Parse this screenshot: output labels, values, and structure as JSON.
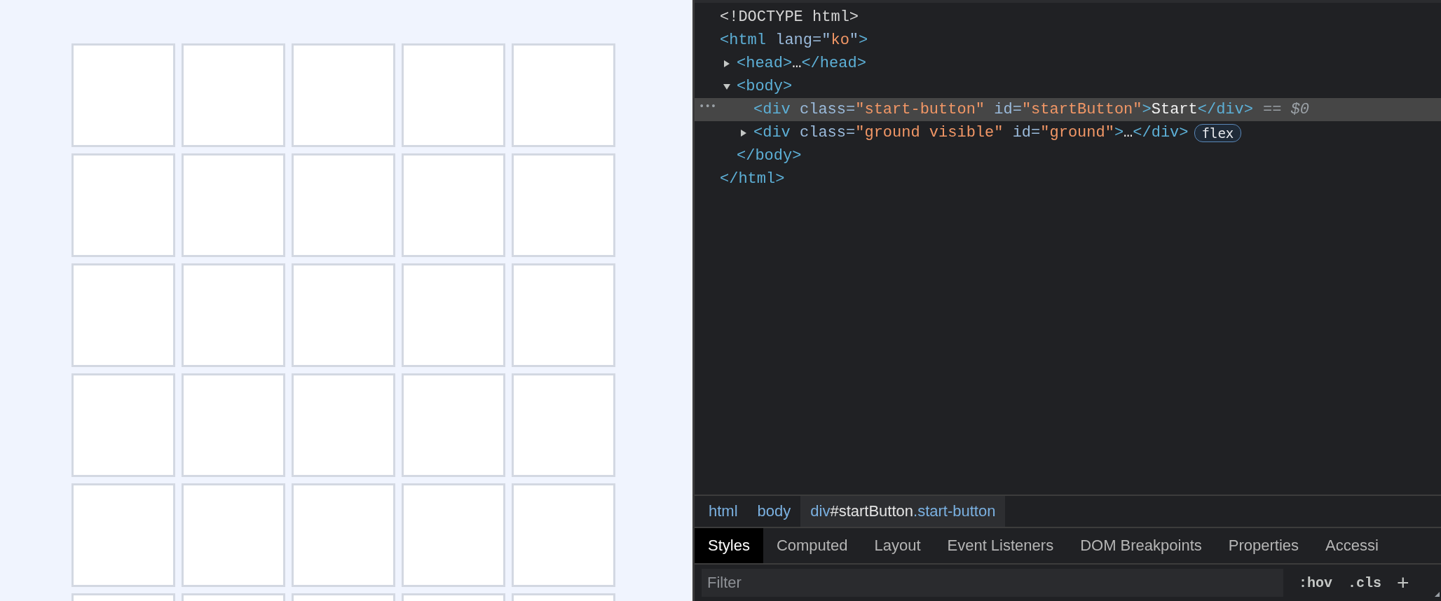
{
  "dom_tree": [
    {
      "selected": false,
      "parts": [
        {
          "kind": "doctype",
          "text": "<!DOCTYPE html>"
        }
      ]
    },
    {
      "selected": false,
      "parts": [
        {
          "kind": "tag",
          "text": "<html"
        },
        {
          "kind": "attr",
          "text": " lang=\""
        },
        {
          "kind": "value",
          "text": "ko"
        },
        {
          "kind": "attr",
          "text": "\""
        },
        {
          "kind": "tag",
          "text": ">"
        }
      ],
      "closing": [
        {
          "kind": "tag",
          "text": "</html>"
        }
      ],
      "children": [
        {
          "selected": false,
          "expanded": false,
          "parts": [
            {
              "kind": "tag",
              "text": "<head>"
            },
            {
              "kind": "text",
              "text": "…"
            },
            {
              "kind": "tag",
              "text": "</head>"
            }
          ]
        },
        {
          "selected": false,
          "expanded": true,
          "parts": [
            {
              "kind": "tag",
              "text": "<body>"
            }
          ],
          "closing": [
            {
              "kind": "tag",
              "text": "</body>"
            }
          ],
          "children": [
            {
              "selected": true,
              "marker": "•••",
              "suffix": "== $0",
              "parts": [
                {
                  "kind": "tag",
                  "text": "<div"
                },
                {
                  "kind": "attr",
                  "text": " class="
                },
                {
                  "kind": "value",
                  "text": "\"start-button\""
                },
                {
                  "kind": "attr",
                  "text": " id="
                },
                {
                  "kind": "value",
                  "text": "\"startButton\""
                },
                {
                  "kind": "tag",
                  "text": ">"
                },
                {
                  "kind": "text",
                  "text": "Start"
                },
                {
                  "kind": "tag",
                  "text": "</div>"
                }
              ]
            },
            {
              "selected": false,
              "expanded": false,
              "badge": "flex",
              "parts": [
                {
                  "kind": "tag",
                  "text": "<div"
                },
                {
                  "kind": "attr",
                  "text": " class="
                },
                {
                  "kind": "value",
                  "text": "\"ground visible\""
                },
                {
                  "kind": "attr",
                  "text": " id="
                },
                {
                  "kind": "value",
                  "text": "\"ground\""
                },
                {
                  "kind": "tag",
                  "text": ">"
                },
                {
                  "kind": "text",
                  "text": "…"
                },
                {
                  "kind": "tag",
                  "text": "</div>"
                }
              ]
            }
          ]
        }
      ]
    }
  ],
  "breadcrumbs": [
    {
      "selected": false,
      "parts": [
        {
          "kind": "tag",
          "text": "html"
        }
      ]
    },
    {
      "selected": false,
      "parts": [
        {
          "kind": "tag",
          "text": "body"
        }
      ]
    },
    {
      "selected": true,
      "parts": [
        {
          "kind": "tag",
          "text": "div"
        },
        {
          "kind": "id",
          "text": "#startButton"
        },
        {
          "kind": "tag",
          "text": ".start-button"
        }
      ]
    }
  ],
  "tabs": [
    {
      "label": "Styles",
      "selected": true
    },
    {
      "label": "Computed",
      "selected": false
    },
    {
      "label": "Layout",
      "selected": false
    },
    {
      "label": "Event Listeners",
      "selected": false
    },
    {
      "label": "DOM Breakpoints",
      "selected": false
    },
    {
      "label": "Properties",
      "selected": false
    },
    {
      "label": "Accessi",
      "selected": false
    }
  ],
  "filter": {
    "placeholder": "Filter",
    "hov": ":hov",
    "cls": ".cls",
    "add": "+"
  }
}
